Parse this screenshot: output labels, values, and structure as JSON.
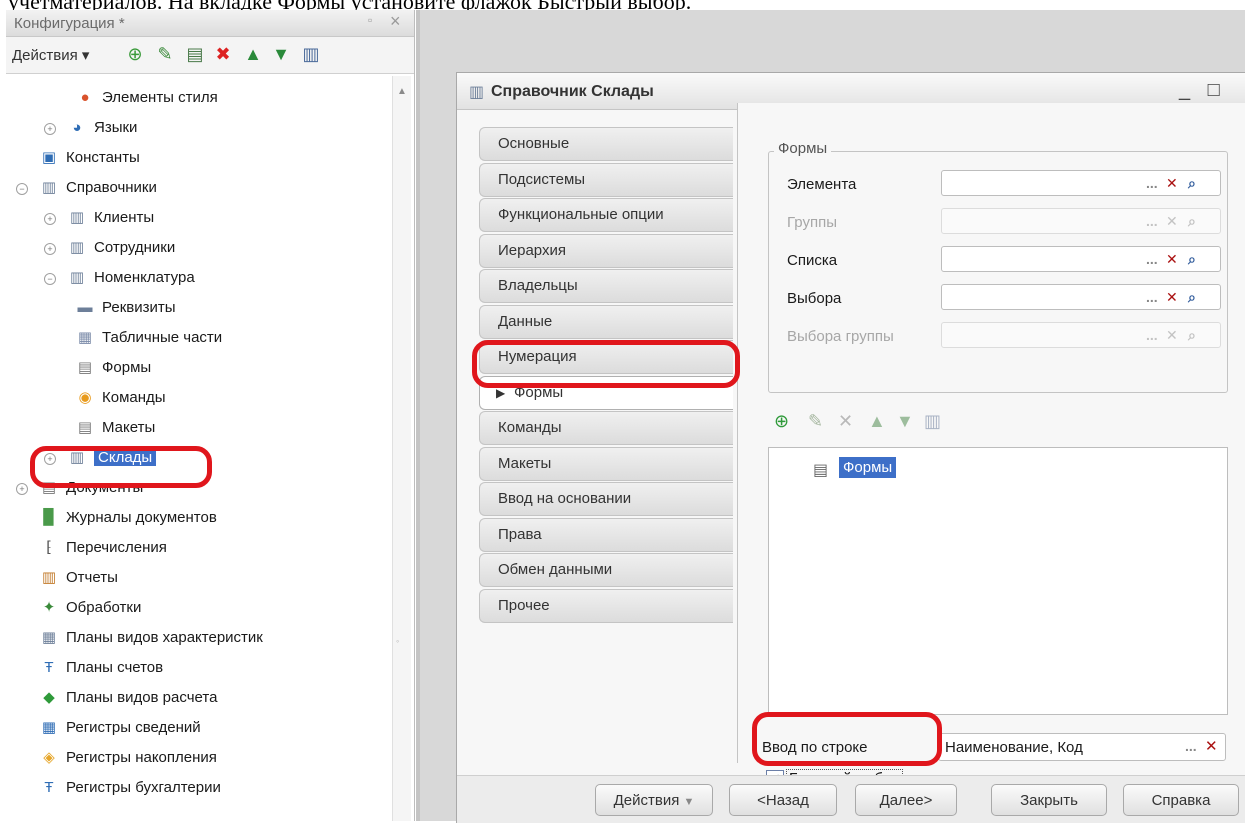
{
  "caption_text": "учетматериалов. На вкладке Формы установите флажок Быстрый выбор.",
  "left_panel": {
    "title": "Конфигурация *",
    "actions_label": "Действия ▾",
    "tree": [
      {
        "label": "Элементы стиля",
        "icon": "style-elements-icon",
        "level": 2,
        "expander": ""
      },
      {
        "label": "Языки",
        "icon": "languages-icon",
        "level": 1,
        "expander": "+"
      },
      {
        "label": "Константы",
        "icon": "constants-icon",
        "level": 0,
        "expander": ""
      },
      {
        "label": "Справочники",
        "icon": "catalogs-icon",
        "level": 0,
        "expander": "−"
      },
      {
        "label": "Клиенты",
        "icon": "catalog-icon",
        "level": 1,
        "expander": "+"
      },
      {
        "label": "Сотрудники",
        "icon": "catalog-icon",
        "level": 1,
        "expander": "+"
      },
      {
        "label": "Номенклатура",
        "icon": "catalog-icon",
        "level": 1,
        "expander": "−"
      },
      {
        "label": "Реквизиты",
        "icon": "attributes-icon",
        "level": 2,
        "expander": ""
      },
      {
        "label": "Табличные части",
        "icon": "tabular-sections-icon",
        "level": 2,
        "expander": ""
      },
      {
        "label": "Формы",
        "icon": "forms-icon",
        "level": 2,
        "expander": ""
      },
      {
        "label": "Команды",
        "icon": "commands-icon",
        "level": 2,
        "expander": ""
      },
      {
        "label": "Макеты",
        "icon": "templates-icon",
        "level": 2,
        "expander": ""
      },
      {
        "label": "Склады",
        "icon": "catalog-icon",
        "level": 1,
        "expander": "+",
        "selected": true
      },
      {
        "label": "Документы",
        "icon": "documents-icon",
        "level": 0,
        "expander": "+"
      },
      {
        "label": "Журналы документов",
        "icon": "document-journals-icon",
        "level": 0,
        "expander": ""
      },
      {
        "label": "Перечисления",
        "icon": "enums-icon",
        "level": 0,
        "expander": ""
      },
      {
        "label": "Отчеты",
        "icon": "reports-icon",
        "level": 0,
        "expander": ""
      },
      {
        "label": "Обработки",
        "icon": "data-processors-icon",
        "level": 0,
        "expander": ""
      },
      {
        "label": "Планы видов характеристик",
        "icon": "characteristic-types-icon",
        "level": 0,
        "expander": ""
      },
      {
        "label": "Планы счетов",
        "icon": "chart-of-accounts-icon",
        "level": 0,
        "expander": ""
      },
      {
        "label": "Планы видов расчета",
        "icon": "calculation-types-icon",
        "level": 0,
        "expander": ""
      },
      {
        "label": "Регистры сведений",
        "icon": "information-registers-icon",
        "level": 0,
        "expander": ""
      },
      {
        "label": "Регистры накопления",
        "icon": "accumulation-registers-icon",
        "level": 0,
        "expander": ""
      },
      {
        "label": "Регистры бухгалтерии",
        "icon": "accounting-registers-icon",
        "level": 0,
        "expander": ""
      }
    ]
  },
  "dialog": {
    "title": "Справочник Склады",
    "tabs": [
      {
        "label": "Основные"
      },
      {
        "label": "Подсистемы"
      },
      {
        "label": "Функциональные опции"
      },
      {
        "label": "Иерархия"
      },
      {
        "label": "Владельцы"
      },
      {
        "label": "Данные"
      },
      {
        "label": "Нумерация"
      },
      {
        "label": "Формы",
        "active": true
      },
      {
        "label": "Команды"
      },
      {
        "label": "Макеты"
      },
      {
        "label": "Ввод на основании"
      },
      {
        "label": "Права"
      },
      {
        "label": "Обмен данными"
      },
      {
        "label": "Прочее"
      }
    ],
    "forms_group_label": "Формы",
    "form_fields": [
      {
        "label": "Элемента",
        "value": "",
        "disabled": false
      },
      {
        "label": "Группы",
        "value": "",
        "disabled": true
      },
      {
        "label": "Списка",
        "value": "",
        "disabled": false
      },
      {
        "label": "Выбора",
        "value": "",
        "disabled": false
      },
      {
        "label": "Выбора группы",
        "value": "",
        "disabled": true
      }
    ],
    "forms_list": [
      {
        "label": "Формы",
        "selected": true
      }
    ],
    "input_by_string_label": "Ввод по строке",
    "input_by_string_value": "Наименование, Код",
    "quick_select": {
      "label": "Быстрый выбор",
      "checked": true
    },
    "buttons": {
      "actions": "Действия",
      "back": "<Назад",
      "next": "Далее>",
      "close": "Закрыть",
      "help": "Справка"
    }
  },
  "colors": {
    "selection": "#3d6fc8",
    "highlight": "#e0161c"
  }
}
